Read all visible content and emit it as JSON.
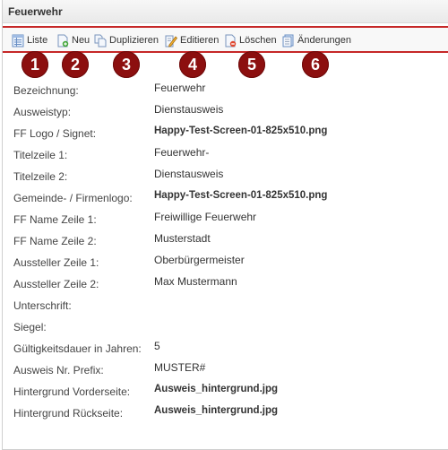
{
  "window": {
    "title": "Feuerwehr"
  },
  "toolbar": {
    "items": [
      {
        "label": "Liste",
        "icon": "list-icon"
      },
      {
        "label": "Neu",
        "icon": "new-document-icon"
      },
      {
        "label": "Duplizieren",
        "icon": "duplicate-icon"
      },
      {
        "label": "Editieren",
        "icon": "edit-icon"
      },
      {
        "label": "Löschen",
        "icon": "delete-icon"
      },
      {
        "label": "Änderungen",
        "icon": "changes-icon"
      }
    ]
  },
  "badges": [
    "1",
    "2",
    "3",
    "4",
    "5",
    "6"
  ],
  "fields": [
    {
      "label": "Bezeichnung:",
      "value": "Feuerwehr"
    },
    {
      "label": "Ausweistyp:",
      "value": "Dienstausweis"
    },
    {
      "label": "FF Logo / Signet:",
      "value": "Happy-Test-Screen-01-825x510.png"
    },
    {
      "label": "Titelzeile 1:",
      "value": "Feuerwehr-"
    },
    {
      "label": "Titelzeile 2:",
      "value": "Dienstausweis"
    },
    {
      "label": "Gemeinde- / Firmenlogo:",
      "value": "Happy-Test-Screen-01-825x510.png"
    },
    {
      "label": "FF Name Zeile 1:",
      "value": "Freiwillige Feuerwehr"
    },
    {
      "label": "FF Name Zeile 2:",
      "value": "Musterstadt"
    },
    {
      "label": "Aussteller Zeile 1:",
      "value": "Oberbürgermeister"
    },
    {
      "label": "Aussteller Zeile 2:",
      "value": "Max Mustermann"
    },
    {
      "label": "Unterschrift:",
      "value": ""
    },
    {
      "label": "Siegel:",
      "value": ""
    },
    {
      "label": "Gültigkeitsdauer in Jahren:",
      "value": "5"
    },
    {
      "label": "Ausweis Nr. Prefix:",
      "value": "MUSTER#"
    },
    {
      "label": "Hintergrund Vorderseite:",
      "value": "Ausweis_hintergrund.jpg"
    },
    {
      "label": "Hintergrund Rückseite:",
      "value": "Ausweis_hintergrund.jpg"
    }
  ],
  "colors": {
    "accent": "#c62828",
    "badge": "#8c0f0f"
  }
}
